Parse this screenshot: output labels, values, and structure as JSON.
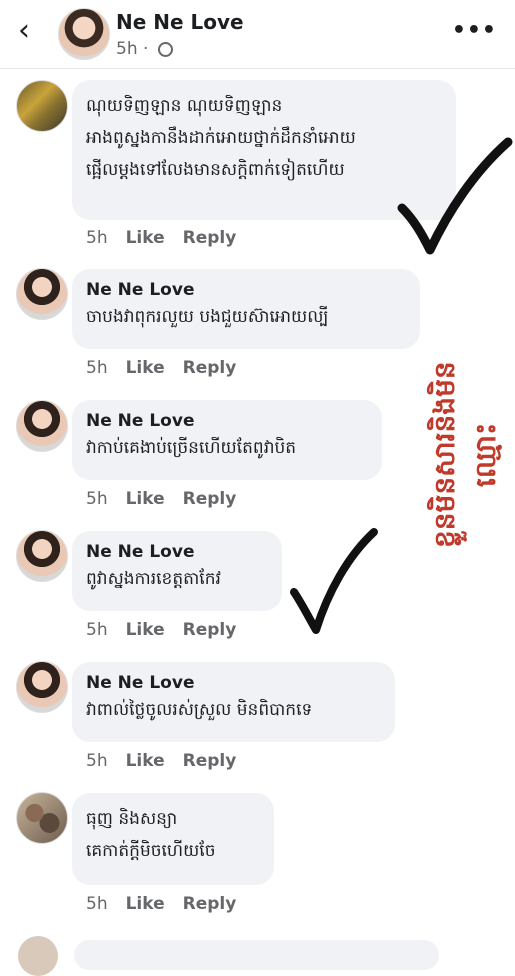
{
  "header": {
    "back_icon": "chevron-left-icon",
    "name": "Ne Ne Love",
    "time": "5h",
    "separator": "·",
    "more_icon": "more-dots-icon"
  },
  "comments": [
    {
      "name": "",
      "text": "ណុយទិញឡាន ណុយទិញឡាន\nអាងពូស្នងកានឹងដាក់អោយថ្នាក់ដឹកនាំអោយ\nផ្អើលម្តងទៅលែងមានសក្តិពាក់ទៀតហើយ",
      "time": "5h",
      "like": "Like",
      "reply": "Reply",
      "avatar": "gold-bars-avatar"
    },
    {
      "name": "Ne Ne Love",
      "text": "ចាបងវាពុករលួយ បងជួយស៊ាអោយល្បី",
      "time": "5h",
      "like": "Like",
      "reply": "Reply",
      "avatar": "woman-avatar"
    },
    {
      "name": "Ne Ne Love",
      "text": "វាកាប់គេងាប់ច្រើនហើយតែពូវាបិត",
      "time": "5h",
      "like": "Like",
      "reply": "Reply",
      "avatar": "woman-avatar"
    },
    {
      "name": "Ne Ne Love",
      "text": "ពូវាស្នងការខេត្តតាកែវ",
      "time": "5h",
      "like": "Like",
      "reply": "Reply",
      "avatar": "woman-avatar"
    },
    {
      "name": "Ne Ne Love",
      "text": "វាពាល់ថ្លៃចូលរស់ស្រួល មិនពិបាកទេ",
      "time": "5h",
      "like": "Like",
      "reply": "Reply",
      "avatar": "woman-avatar"
    },
    {
      "name": "",
      "text": "ធុញ និងសន្យា\nគេកាត់ក្តីមិចហើយចែ",
      "time": "5h",
      "like": "Like",
      "reply": "Reply",
      "avatar": "pets-avatar"
    }
  ],
  "annotation": "ខ្លួនមិនសារនិងមិនឈ្មោះ",
  "colors": {
    "bubble": "#f0f2f5",
    "annotation": "#c0392b",
    "meta": "#65676b"
  }
}
